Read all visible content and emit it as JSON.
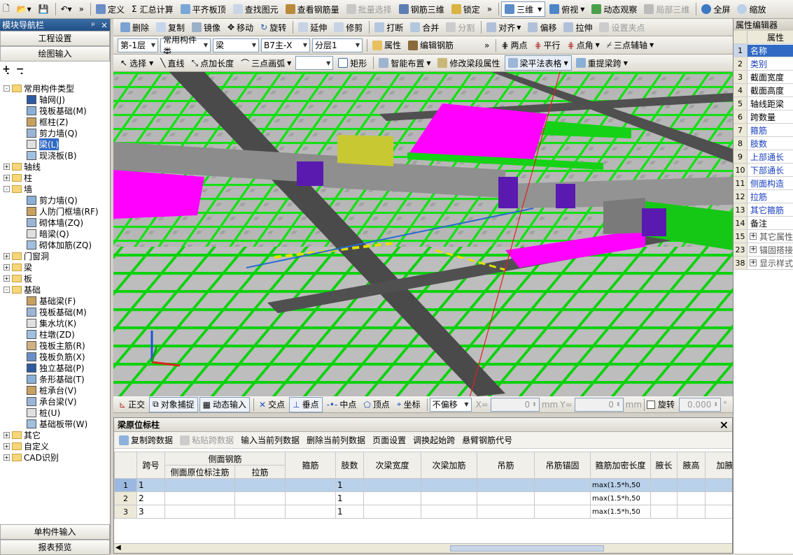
{
  "toolbar1": {
    "items": [
      "定义",
      "汇总计算",
      "平齐板顶",
      "查找图元",
      "查看钢筋量",
      "批量选择",
      "钢筋三维",
      "锁定"
    ],
    "view_mode": "三维",
    "view_items": [
      "俯视",
      "动态观察",
      "局部三维"
    ],
    "right_items": [
      "全屏",
      "缩放"
    ]
  },
  "toolbar2": {
    "items": [
      "删除",
      "复制",
      "镜像",
      "移动",
      "旋转",
      "延伸",
      "修剪",
      "打断",
      "合并",
      "分割",
      "对齐",
      "偏移",
      "拉伸",
      "设置夹点"
    ]
  },
  "toolbar3": {
    "floor": "第-1层",
    "category": "常用构件类",
    "type": "梁",
    "component": "B7主-X",
    "layer": "分层1",
    "items": [
      "属性",
      "编辑钢筋",
      "两点",
      "平行",
      "点角",
      "三点辅轴"
    ]
  },
  "toolbar4": {
    "items": [
      "选择",
      "直线",
      "点加长度",
      "三点画弧",
      "矩形",
      "智能布置",
      "修改梁段属性",
      "梁平法表格",
      "重提梁跨"
    ]
  },
  "nav": {
    "title": "模块导航栏",
    "pin": "ᵖ",
    "close": "×",
    "btn_settings": "工程设置",
    "btn_draw": "绘图输入",
    "btn_single": "单构件输入",
    "btn_report": "报表预览",
    "tree": [
      {
        "label": "常用构件类型",
        "level": 0,
        "expand": "-"
      },
      {
        "label": "轴网(J)",
        "level": 1
      },
      {
        "label": "筏板基础(M)",
        "level": 1
      },
      {
        "label": "框柱(Z)",
        "level": 1
      },
      {
        "label": "剪力墙(Q)",
        "level": 1
      },
      {
        "label": "梁(L)",
        "level": 1
      },
      {
        "label": "现浇板(B)",
        "level": 1
      },
      {
        "label": "轴线",
        "level": 0,
        "expand": "+"
      },
      {
        "label": "柱",
        "level": 0,
        "expand": "+"
      },
      {
        "label": "墙",
        "level": 0,
        "expand": "-"
      },
      {
        "label": "剪力墙(Q)",
        "level": 1
      },
      {
        "label": "人防门框墙(RF)",
        "level": 1
      },
      {
        "label": "砌体墙(ZQ)",
        "level": 1
      },
      {
        "label": "暗梁(Q)",
        "level": 1
      },
      {
        "label": "砌体加筋(ZQ)",
        "level": 1
      },
      {
        "label": "门窗洞",
        "level": 0,
        "expand": "+"
      },
      {
        "label": "梁",
        "level": 0,
        "expand": "+"
      },
      {
        "label": "板",
        "level": 0,
        "expand": "+"
      },
      {
        "label": "基础",
        "level": 0,
        "expand": "-"
      },
      {
        "label": "基础梁(F)",
        "level": 1
      },
      {
        "label": "筏板基础(M)",
        "level": 1
      },
      {
        "label": "集水坑(K)",
        "level": 1
      },
      {
        "label": "柱墩(ZD)",
        "level": 1
      },
      {
        "label": "筏板主筋(R)",
        "level": 1
      },
      {
        "label": "筏板负筋(X)",
        "level": 1
      },
      {
        "label": "独立基础(P)",
        "level": 1
      },
      {
        "label": "条形基础(T)",
        "level": 1
      },
      {
        "label": "桩承台(V)",
        "level": 1
      },
      {
        "label": "承台梁(V)",
        "level": 1
      },
      {
        "label": "桩(U)",
        "level": 1
      },
      {
        "label": "基础板带(W)",
        "level": 1
      },
      {
        "label": "其它",
        "level": 0,
        "expand": "+"
      },
      {
        "label": "自定义",
        "level": 0,
        "expand": "+"
      },
      {
        "label": "CAD识别",
        "level": 0,
        "expand": "+"
      }
    ]
  },
  "props": {
    "title": "属性编辑器",
    "col_header": "属性",
    "rows": [
      [
        "1",
        "名称"
      ],
      [
        "2",
        "类别"
      ],
      [
        "3",
        "截面宽度"
      ],
      [
        "4",
        "截面高度"
      ],
      [
        "5",
        "轴线距梁"
      ],
      [
        "6",
        "跨数量"
      ],
      [
        "7",
        "箍筋"
      ],
      [
        "8",
        "肢数"
      ],
      [
        "9",
        "上部通长"
      ],
      [
        "10",
        "下部通长"
      ],
      [
        "11",
        "侧面构造"
      ],
      [
        "12",
        "拉筋"
      ],
      [
        "13",
        "其它箍筋"
      ],
      [
        "14",
        "备注"
      ],
      [
        "15",
        "其它属性"
      ],
      [
        "23",
        "锚固搭接"
      ],
      [
        "38",
        "显示样式"
      ]
    ]
  },
  "snap": {
    "items": [
      "正交",
      "对象捕捉",
      "动态输入",
      "交点",
      "垂点",
      "中点",
      "顶点",
      "坐标"
    ],
    "offset_mode": "不偏移",
    "x_label": "X=",
    "x_val": "0",
    "y_label": "Y=",
    "y_val": "0",
    "unit": "mm",
    "rotate_label": "旋转",
    "rotate_val": "0.000",
    "deg": "°"
  },
  "panel": {
    "title": "梁原位标柱",
    "close": "×",
    "actions": [
      "复制跨数据",
      "粘贴跨数据",
      "输入当前列数据",
      "删除当前列数据",
      "页面设置",
      "调换起始跨",
      "悬臂钢筋代号"
    ],
    "headers": {
      "span": "跨号",
      "side": "侧面钢筋",
      "side_anno": "侧面原位标注筋",
      "tie": "拉筋",
      "stirrup": "箍筋",
      "legs": "肢数",
      "sec_w": "次梁宽度",
      "sec_add": "次梁加筋",
      "hanger": "吊筋",
      "hanger_anchor": "吊筋锚固",
      "dense_len": "箍筋加密长度",
      "haunch_len": "腋长",
      "haunch_h": "腋高",
      "extra": "加腋"
    },
    "rows": [
      {
        "n": "1",
        "span": "1",
        "legs": "1",
        "dense": "max(1.5*h,50"
      },
      {
        "n": "2",
        "span": "2",
        "legs": "1",
        "dense": "max(1.5*h,50"
      },
      {
        "n": "3",
        "span": "3",
        "legs": "1",
        "dense": "max(1.5*h,50"
      }
    ]
  },
  "colors": {
    "accent": "#316ac5",
    "magenta": "#ff00ff",
    "green": "#00e000",
    "beam_gray": "#8c8c8c",
    "purple": "#5a1ab0",
    "yellow": "#c8c832"
  }
}
